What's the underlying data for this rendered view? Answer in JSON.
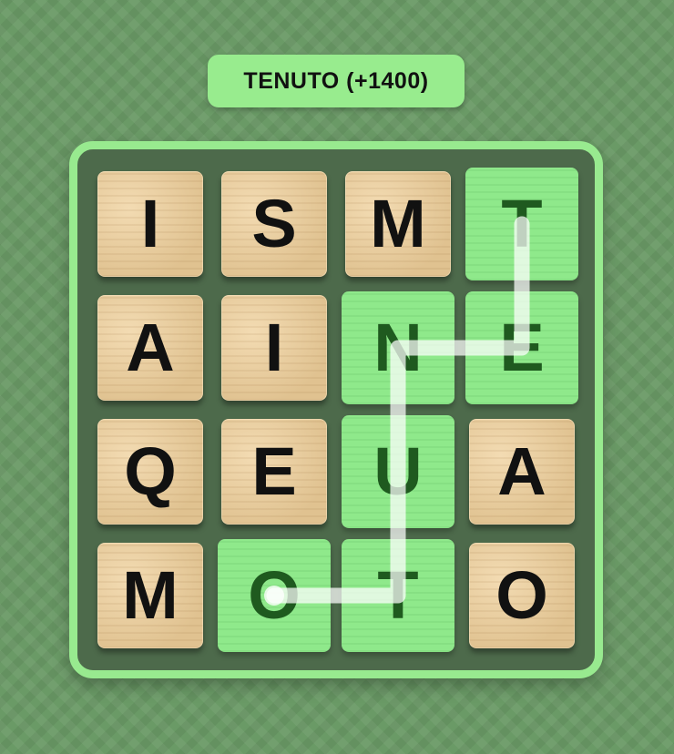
{
  "header": {
    "found_word_label": "TENUTO (+1400)"
  },
  "colors": {
    "background": "#6a9a66",
    "board_frame": "#98ea8f",
    "board_inner": "#4d6a4b",
    "tile_wood": "#e4c898",
    "tile_selected": "#8fe98b",
    "banner": "#98ec8e"
  },
  "grid": {
    "rows": [
      [
        {
          "letter": "I",
          "selected": false
        },
        {
          "letter": "S",
          "selected": false
        },
        {
          "letter": "M",
          "selected": false
        },
        {
          "letter": "T",
          "selected": true
        }
      ],
      [
        {
          "letter": "A",
          "selected": false
        },
        {
          "letter": "I",
          "selected": false
        },
        {
          "letter": "N",
          "selected": true
        },
        {
          "letter": "E",
          "selected": true
        }
      ],
      [
        {
          "letter": "Q",
          "selected": false
        },
        {
          "letter": "E",
          "selected": false
        },
        {
          "letter": "U",
          "selected": true
        },
        {
          "letter": "A",
          "selected": false
        }
      ],
      [
        {
          "letter": "M",
          "selected": false
        },
        {
          "letter": "O",
          "selected": true
        },
        {
          "letter": "T",
          "selected": true
        },
        {
          "letter": "O",
          "selected": false
        }
      ]
    ],
    "selected_path": [
      [
        0,
        3
      ],
      [
        1,
        3
      ],
      [
        1,
        2
      ],
      [
        2,
        2
      ],
      [
        3,
        2
      ],
      [
        3,
        1
      ]
    ]
  }
}
